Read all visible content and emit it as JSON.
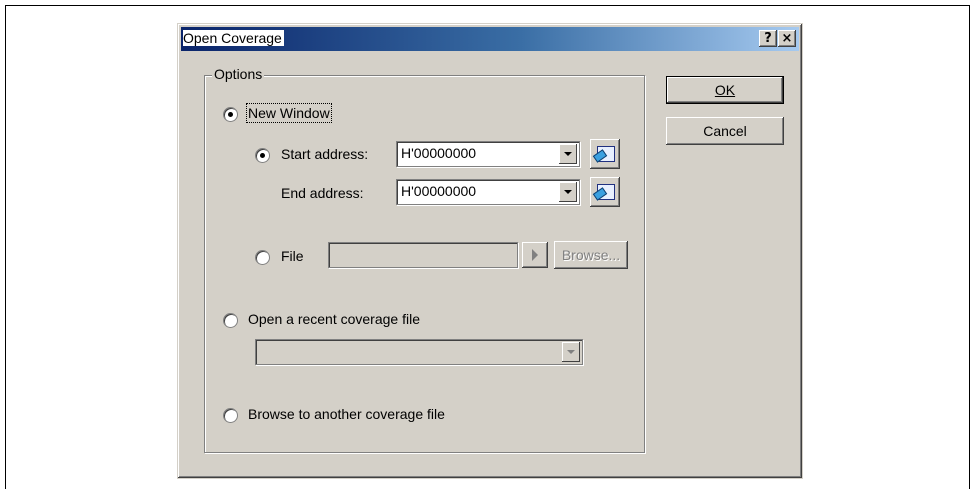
{
  "window": {
    "title": "Open Coverage",
    "help_label": "?",
    "close_label": "×"
  },
  "buttons": {
    "ok_label": "OK",
    "cancel_label": "Cancel"
  },
  "options": {
    "group_label": "Options",
    "new_window": {
      "label": "New Window",
      "selected": true
    },
    "start_address": {
      "label": "Start address:",
      "value": "H'00000000",
      "selected": true
    },
    "end_address": {
      "label": "End address:",
      "value": "H'00000000"
    },
    "file": {
      "label": "File",
      "value": "",
      "browse_label": "Browse...",
      "selected": false
    },
    "recent": {
      "label": "Open a recent coverage file",
      "value": "",
      "selected": false
    },
    "browse_other": {
      "label": "Browse to another coverage file",
      "selected": false
    }
  },
  "colors": {
    "titlebar_start": "#0a246a",
    "titlebar_end": "#a6caf0",
    "dialog_face": "#d4d0c8"
  }
}
